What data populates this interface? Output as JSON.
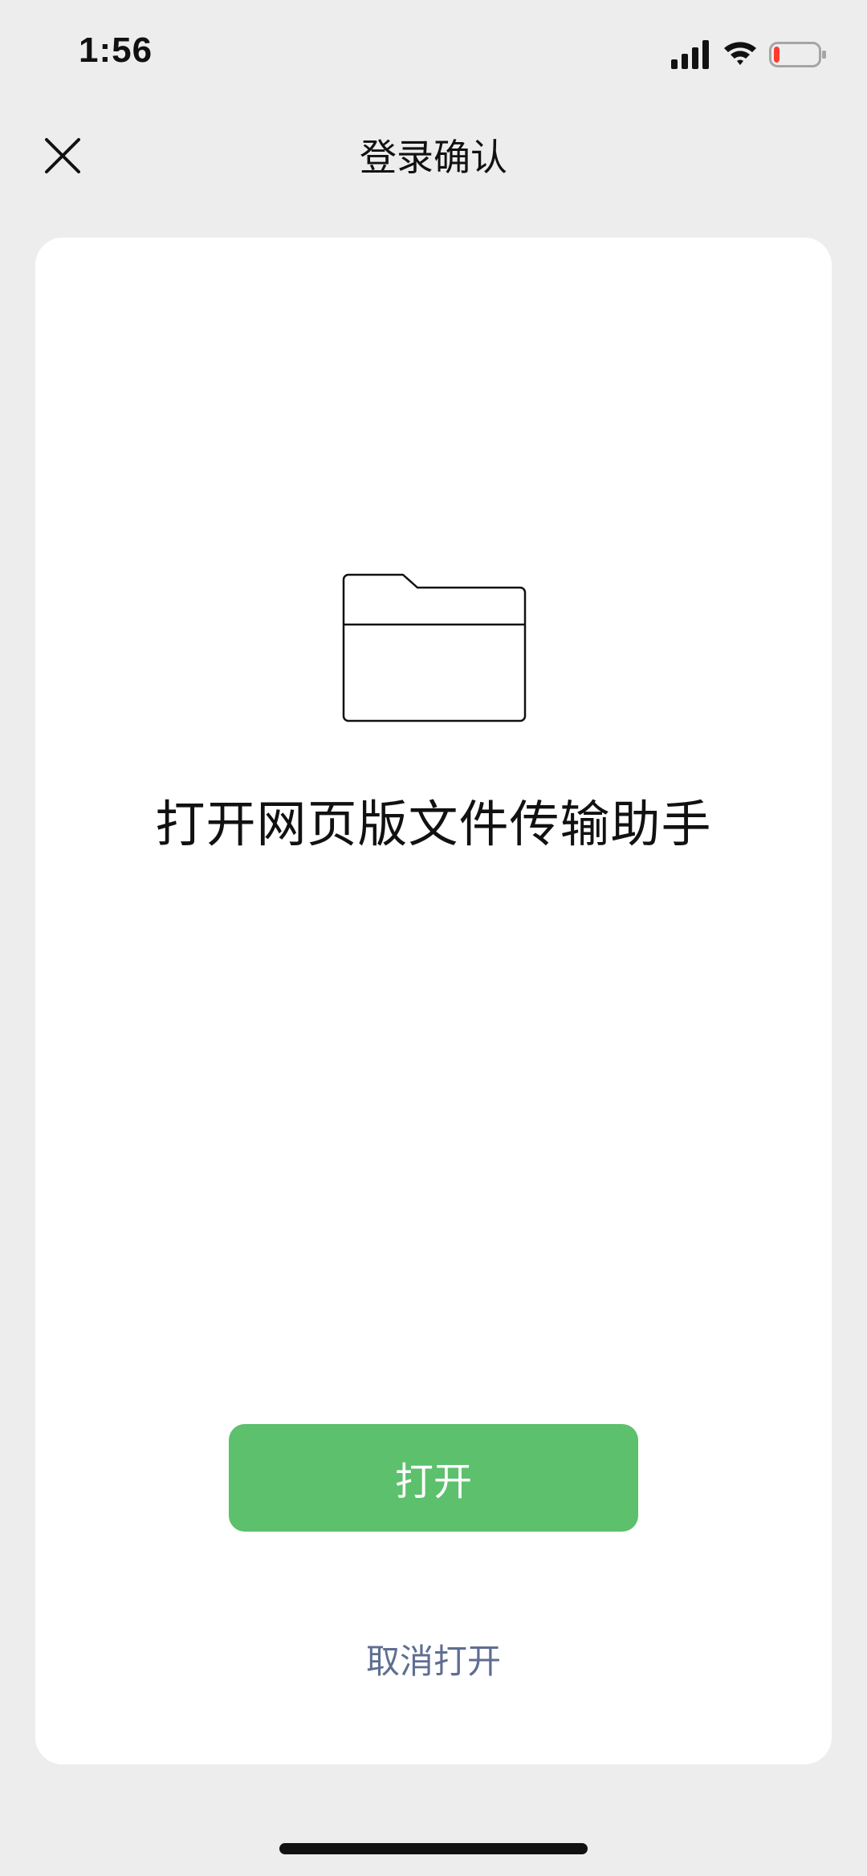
{
  "status_bar": {
    "time": "1:56",
    "icons": [
      "signal-icon",
      "wifi-icon",
      "battery-icon"
    ],
    "battery_level": 0.12,
    "battery_color": "#ff3b30"
  },
  "nav": {
    "title": "登录确认",
    "close_icon": "close-icon"
  },
  "card": {
    "icon": "folder-icon",
    "title": "打开网页版文件传输助手",
    "open_label": "打开",
    "cancel_label": "取消打开"
  },
  "colors": {
    "background": "#ededed",
    "card": "#ffffff",
    "primary_button": "#5cc06c",
    "link": "#5f6e91"
  }
}
